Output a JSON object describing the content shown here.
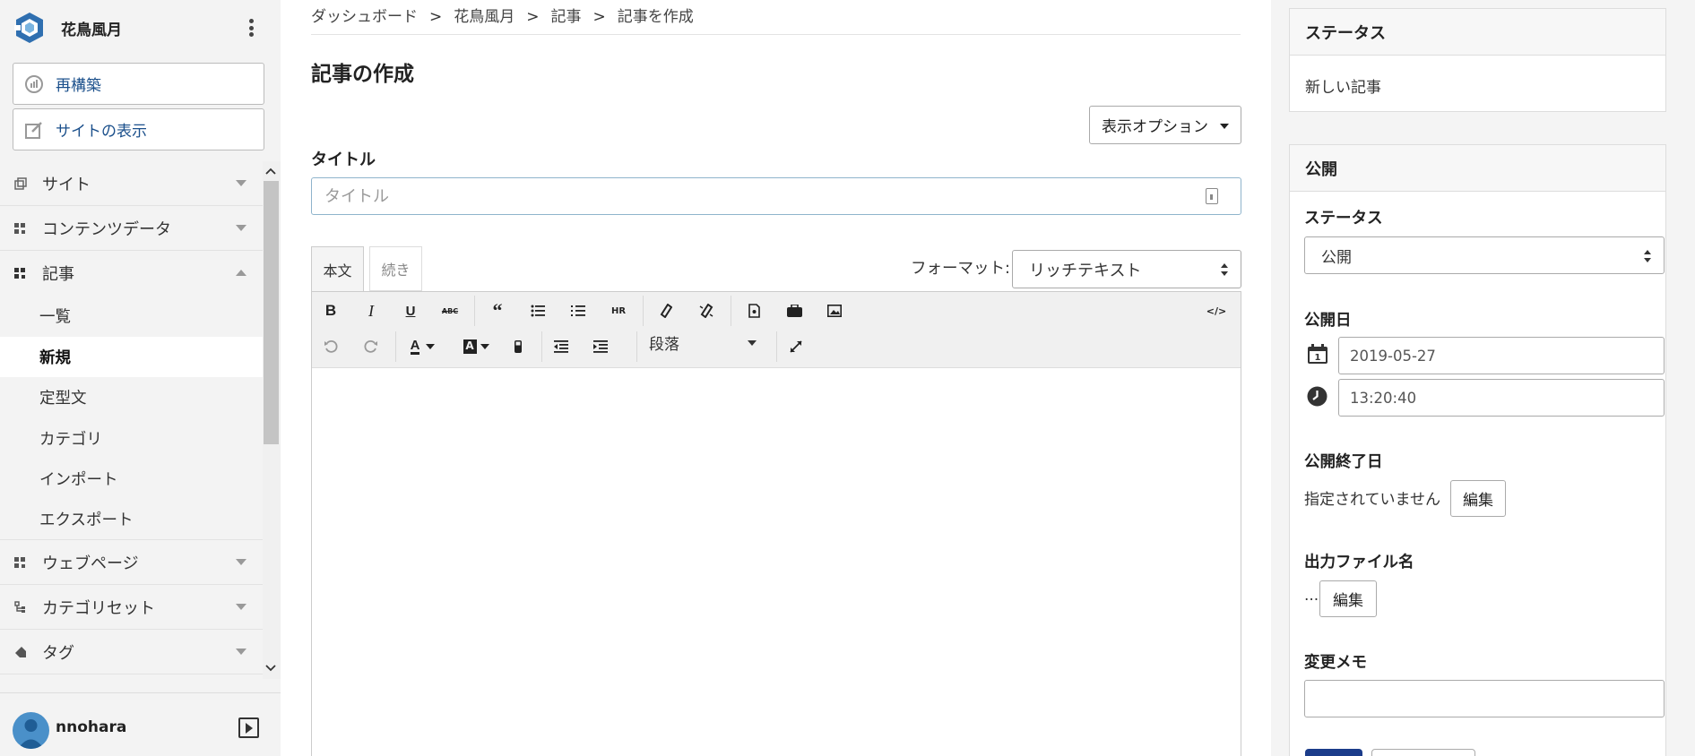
{
  "sidebar": {
    "site_name": "花鳥風月",
    "rebuild_label": "再構築",
    "view_site_label": "サイトの表示",
    "nav": [
      {
        "label": "サイト"
      },
      {
        "label": "コンテンツデータ"
      },
      {
        "label": "記事"
      },
      {
        "label": "ウェブページ"
      },
      {
        "label": "カテゴリセット"
      },
      {
        "label": "タグ"
      }
    ],
    "sub": [
      {
        "label": "一覧"
      },
      {
        "label": "新規"
      },
      {
        "label": "定型文"
      },
      {
        "label": "カテゴリ"
      },
      {
        "label": "インポート"
      },
      {
        "label": "エクスポート"
      }
    ],
    "user": "nnohara"
  },
  "main": {
    "breadcrumbs": [
      "ダッシュボード",
      "花鳥風月",
      "記事",
      "記事を作成"
    ],
    "breadcrumb_sep": ">",
    "title": "記事の作成",
    "display_options": "表示オプション",
    "title_label": "タイトル",
    "title_placeholder": "タイトル",
    "tab_body": "本文",
    "tab_more": "続き",
    "format_label": "フォーマット:",
    "format_value": "リッチテキスト",
    "paragraph_value": "段落"
  },
  "right": {
    "status_panel_title": "ステータス",
    "status_text": "新しい記事",
    "publish_panel_title": "公開",
    "status_label": "ステータス",
    "status_value": "公開",
    "publish_date_label": "公開日",
    "publish_date": "2019-05-27",
    "publish_time": "13:20:40",
    "unpublish_label": "公開終了日",
    "unpublish_text": "指定されていません",
    "edit_label": "編集",
    "basename_label": "出力ファイル名",
    "basename_text": "...",
    "memo_label": "変更メモ"
  },
  "colors": {
    "link": "#1a4f8b",
    "primary": "#1b3c8a",
    "sidebar_bg": "#f3f3f3",
    "panel_bg": "#f4f4f4"
  }
}
